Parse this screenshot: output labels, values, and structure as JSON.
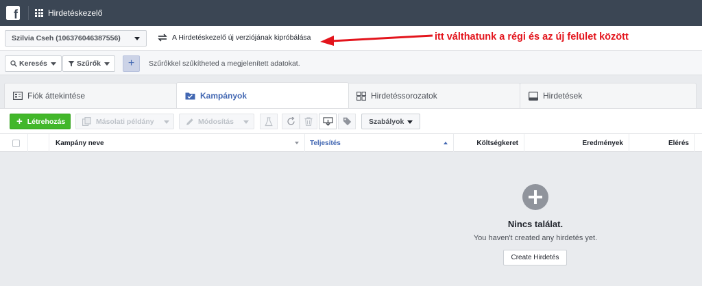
{
  "topbar": {
    "app_title": "Hirdetéskezelő",
    "logo_letter": "f"
  },
  "account": {
    "selected": "Szilvia Cseh (106376046387556)",
    "switch_label": "A Hirdetéskezelő új verziójának kipróbálása"
  },
  "annotation": {
    "text": "itt válthatunk a régi és az új felület között",
    "color": "#e3141c"
  },
  "filterbar": {
    "search_label": "Keresés",
    "filters_label": "Szűrők",
    "add_label": "+",
    "hint": "Szűrőkkel szűkítheted a megjelenített adatokat."
  },
  "tabs": [
    {
      "label": "Fiók áttekintése",
      "icon": "overview-icon"
    },
    {
      "label": "Kampányok",
      "icon": "folder-icon",
      "active": true
    },
    {
      "label": "Hirdetéssorozatok",
      "icon": "grid-icon"
    },
    {
      "label": "Hirdetések",
      "icon": "ad-icon"
    }
  ],
  "toolbar": {
    "create_label": "Létrehozás",
    "duplicate_label": "Másolati példány",
    "edit_label": "Módosítás",
    "rules_label": "Szabályok"
  },
  "table": {
    "columns": [
      "Kampány neve",
      "Teljesítés",
      "Költségkeret",
      "Eredmények",
      "Elérés"
    ]
  },
  "empty_state": {
    "title": "Nincs találat.",
    "description": "You haven't created any hirdetés yet.",
    "button": "Create Hirdetés"
  },
  "colors": {
    "topbar": "#3b4654",
    "accent": "#4267b2",
    "create_green": "#42b72a"
  }
}
